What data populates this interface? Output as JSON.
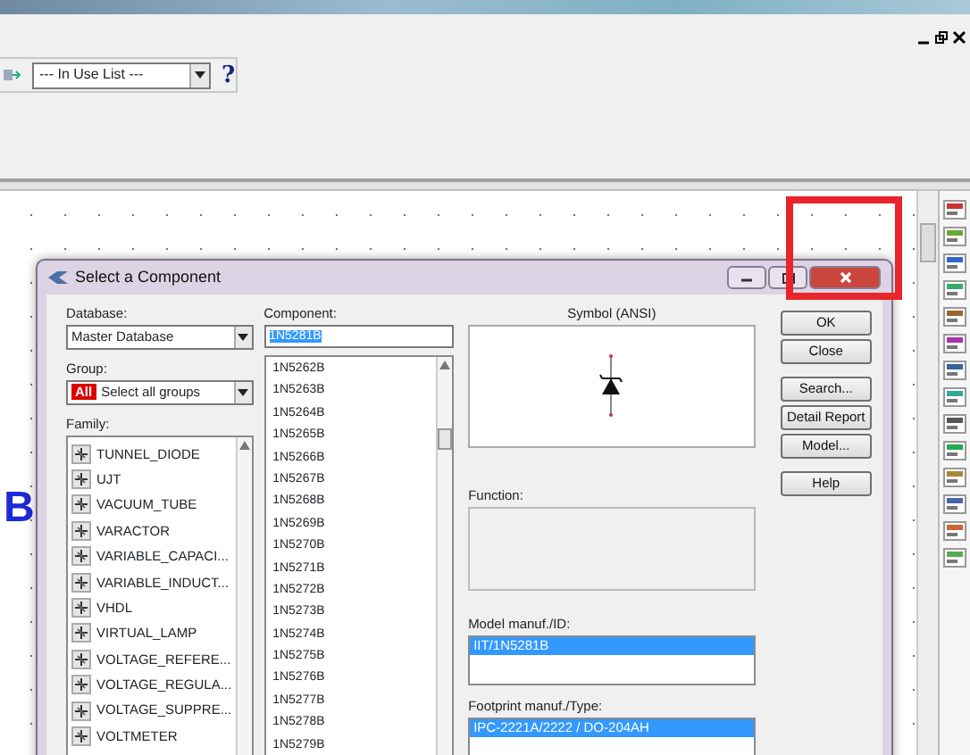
{
  "toolbar": {
    "dropdown": "--- In Use List ---",
    "help": "?"
  },
  "canvas": {
    "marker": "B"
  },
  "dialog": {
    "title": "Select a Component",
    "database": {
      "label": "Database:",
      "value": "Master Database"
    },
    "group": {
      "label": "Group:",
      "badge": "All",
      "value": "Select all groups"
    },
    "family": {
      "label": "Family:",
      "items": [
        {
          "label": "TUNNEL_DIODE",
          "selected": false
        },
        {
          "label": "UJT",
          "selected": false
        },
        {
          "label": "VACUUM_TUBE",
          "selected": false
        },
        {
          "label": "VARACTOR",
          "selected": false
        },
        {
          "label": "VARIABLE_CAPACI...",
          "selected": false
        },
        {
          "label": "VARIABLE_INDUCT...",
          "selected": false
        },
        {
          "label": "VHDL",
          "selected": false
        },
        {
          "label": "VIRTUAL_LAMP",
          "selected": false
        },
        {
          "label": "VOLTAGE_REFERE...",
          "selected": false
        },
        {
          "label": "VOLTAGE_REGULA...",
          "selected": false
        },
        {
          "label": "VOLTAGE_SUPPRE...",
          "selected": false
        },
        {
          "label": "VOLTMETER",
          "selected": false
        }
      ]
    },
    "component": {
      "label": "Component:",
      "value": "1N5281B",
      "items": [
        {
          "label": "1N5262B",
          "selected": false
        },
        {
          "label": "1N5263B",
          "selected": false
        },
        {
          "label": "1N5264B",
          "selected": false
        },
        {
          "label": "1N5265B",
          "selected": false
        },
        {
          "label": "1N5266B",
          "selected": false
        },
        {
          "label": "1N5267B",
          "selected": false
        },
        {
          "label": "1N5268B",
          "selected": false
        },
        {
          "label": "1N5269B",
          "selected": false
        },
        {
          "label": "1N5270B",
          "selected": false
        },
        {
          "label": "1N5271B",
          "selected": false
        },
        {
          "label": "1N5272B",
          "selected": false
        },
        {
          "label": "1N5273B",
          "selected": false
        },
        {
          "label": "1N5274B",
          "selected": false
        },
        {
          "label": "1N5275B",
          "selected": false
        },
        {
          "label": "1N5276B",
          "selected": false
        },
        {
          "label": "1N5277B",
          "selected": false
        },
        {
          "label": "1N5278B",
          "selected": false
        },
        {
          "label": "1N5279B",
          "selected": false
        }
      ]
    },
    "symbol": {
      "label": "Symbol (ANSI)"
    },
    "function": {
      "label": "Function:"
    },
    "model": {
      "label": "Model manuf./ID:",
      "items": [
        {
          "label": "IIT/1N5281B",
          "selected": true
        }
      ]
    },
    "footprint": {
      "label": "Footprint manuf./Type:",
      "items": [
        {
          "label": "IPC-2221A/2222 / DO-204AH",
          "selected": true
        }
      ]
    },
    "buttons": [
      {
        "label": "OK"
      },
      {
        "label": "Close"
      },
      {
        "label": "Search..."
      },
      {
        "label": "Detail Report"
      },
      {
        "label": "Model..."
      },
      {
        "label": "Help"
      }
    ]
  }
}
